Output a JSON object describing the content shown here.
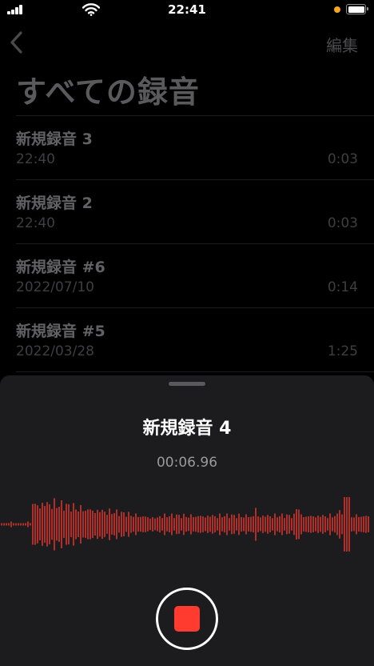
{
  "status_bar": {
    "time": "22:41"
  },
  "nav": {
    "edit_label": "編集"
  },
  "page_title": "すべての録音",
  "recordings": [
    {
      "title": "新規録音 3",
      "date": "22:40",
      "duration": "0:03"
    },
    {
      "title": "新規録音 2",
      "date": "22:40",
      "duration": "0:03"
    },
    {
      "title": "新規録音 #6",
      "date": "2022/07/10",
      "duration": "0:14"
    },
    {
      "title": "新規録音 #5",
      "date": "2022/03/28",
      "duration": "1:25"
    }
  ],
  "recording_sheet": {
    "title": "新規録音 4",
    "elapsed": "00:06.96"
  },
  "colors": {
    "accent_red": "#ff3b30",
    "sheet_bg": "#1c1c1e",
    "waveform": "#ff3b30"
  },
  "icons": {
    "back": "chevron-left-icon",
    "stop": "stop-icon",
    "wifi": "wifi-icon",
    "signal": "cellular-signal-icon",
    "battery": "battery-icon"
  }
}
